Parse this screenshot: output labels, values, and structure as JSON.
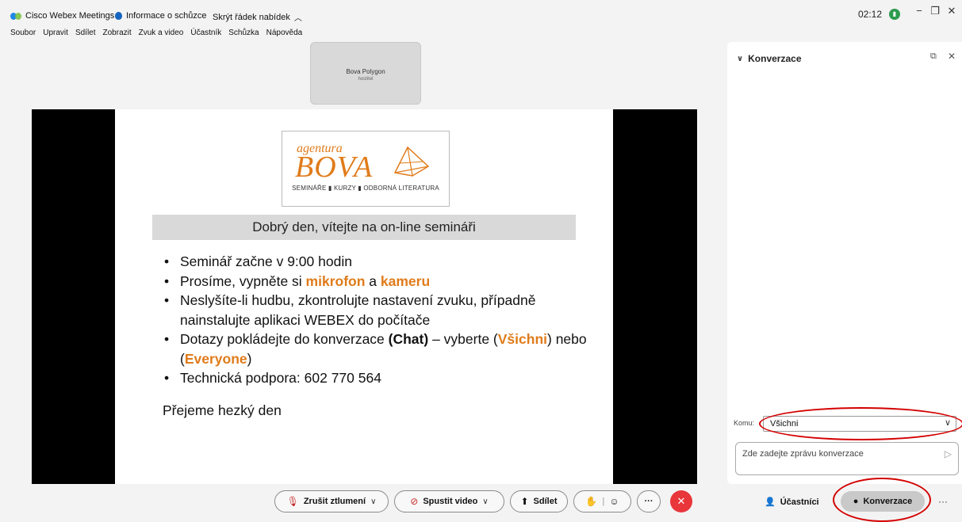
{
  "titlebar": {
    "app_name": "Cisco Webex Meetings",
    "meeting_info": "Informace o schůzce",
    "hide_menu": "Skrýt řádek nabídek",
    "hide_menu_chevron": "^",
    "time": "02:12",
    "network_icon": "signal-icon",
    "minimize": "−",
    "restore": "❐",
    "close": "✕"
  },
  "menu": {
    "items": [
      "Soubor",
      "Upravit",
      "Sdílet",
      "Zobrazit",
      "Zvuk a video",
      "Účastník",
      "Schůzka",
      "Nápověda"
    ]
  },
  "host_tile": {
    "name": "Bova Polygon",
    "role": "hostitel"
  },
  "slide": {
    "logo_agentura": "agentura",
    "logo_bova": "BOVA",
    "logo_tagline": "SEMINÁŘE ▮ KURZY ▮ ODBORNÁ LITERATURA",
    "banner": "Dobrý den, vítejte na on-line semináři",
    "b1": "Seminář začne v 9:00 hodin",
    "b2_pre": "Prosíme, vypněte si ",
    "b2_mic": "mikrofon",
    "b2_mid": " a ",
    "b2_cam": "kameru",
    "b3": "Neslyšíte-li hudbu, zkontrolujte nastavení zvuku, případně nainstalujte aplikaci WEBEX do počítače",
    "b4_pre": "Dotazy pokládejte do konverzace ",
    "b4_chat": "(Chat)",
    "b4_mid": " – vyberte (",
    "b4_vsichni": "Všichni",
    "b4_mid2": ") nebo (",
    "b4_everyone": "Everyone",
    "b4_end": ")",
    "b5_pre": "Technická podpora: ",
    "b5_phone": "602 770 564",
    "closing": "Přejeme hezký den"
  },
  "chat": {
    "title": "Konverzace",
    "to_label": "Komu:",
    "to_value": "Všichni",
    "placeholder": "Zde zadejte zprávu konverzace"
  },
  "toolbar": {
    "unmute": "Zrušit ztlumení",
    "start_video": "Spustit video",
    "share": "Sdílet",
    "participants": "Účastníci",
    "chat": "Konverzace",
    "more": "···"
  },
  "colors": {
    "accent_orange": "#e07b1a",
    "end_red": "#e8363b",
    "annotation_red": "#d40000"
  }
}
